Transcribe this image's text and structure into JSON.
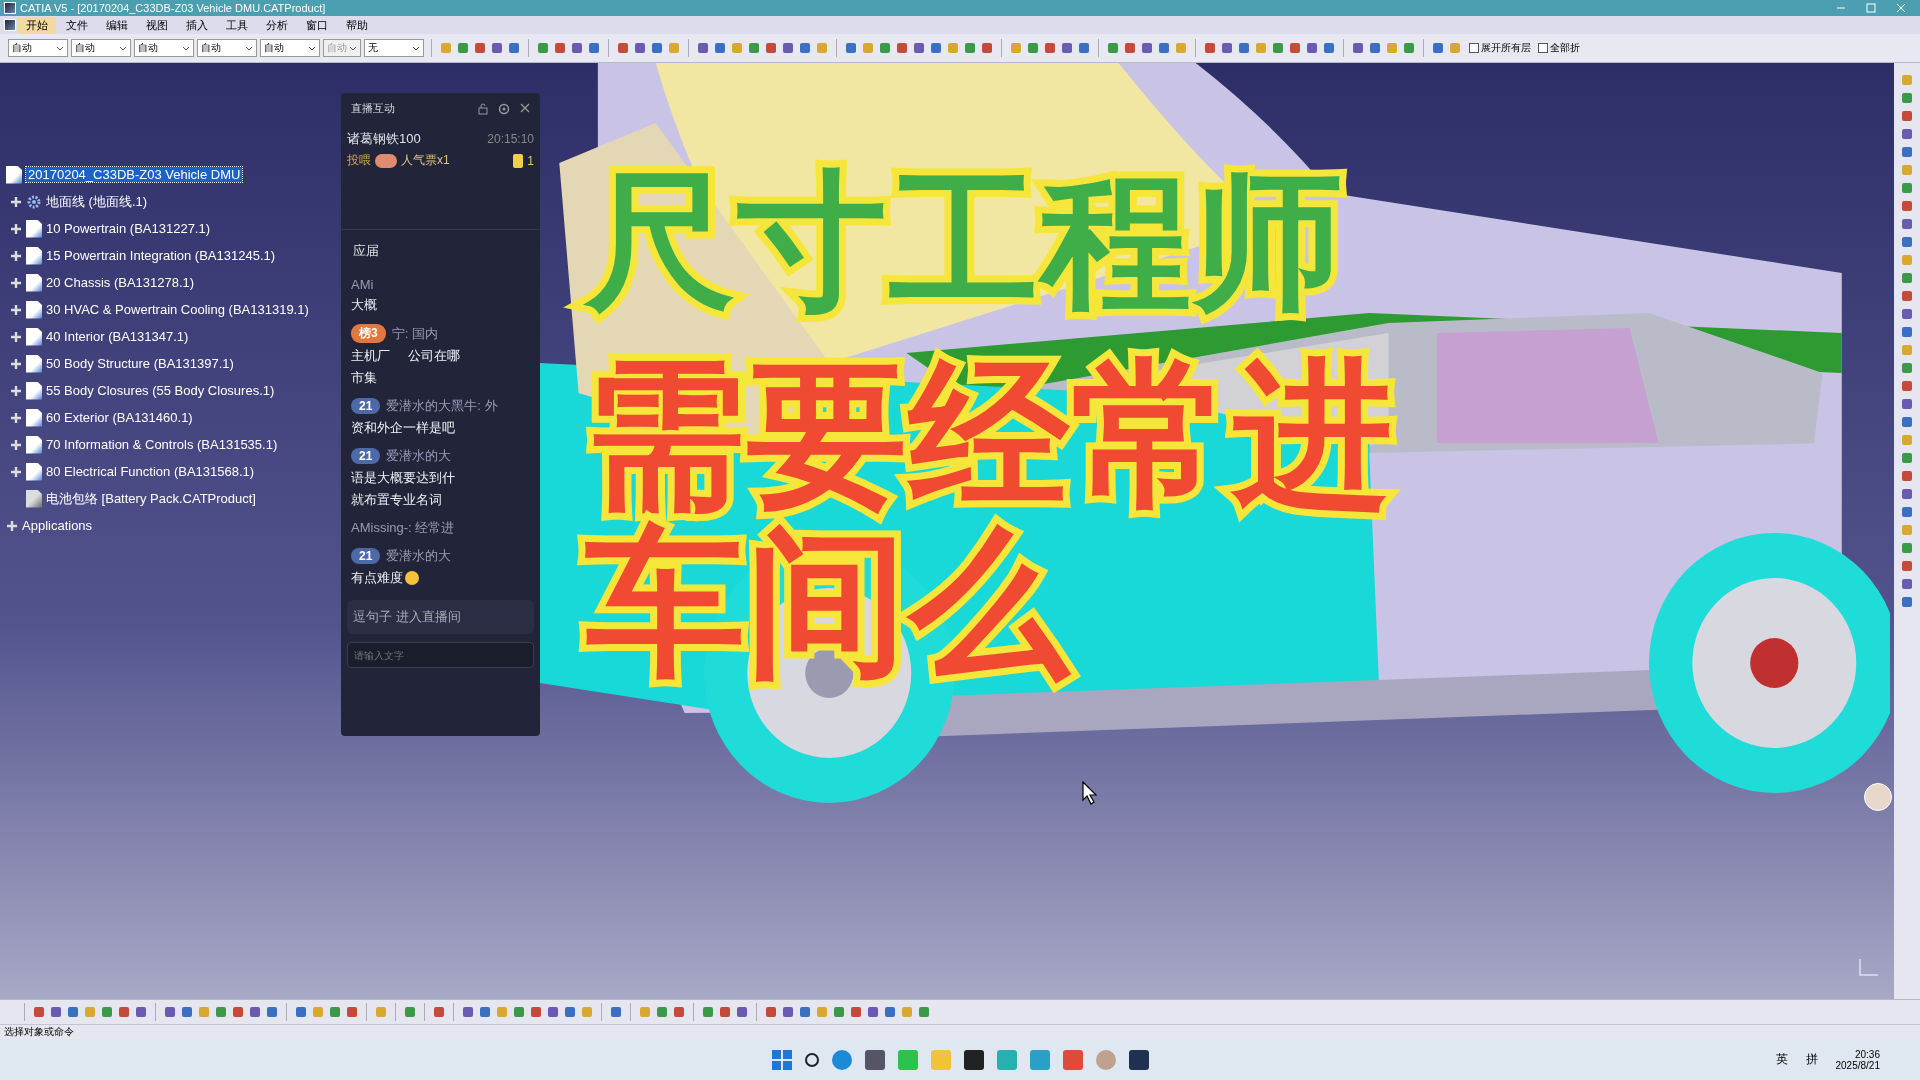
{
  "window": {
    "title": "CATIA V5 - [20170204_C33DB-Z03 Vehicle DMU.CATProduct]"
  },
  "menu": [
    {
      "label": "开始",
      "selected": true
    },
    {
      "label": "文件",
      "selected": false
    },
    {
      "label": "编辑",
      "selected": false
    },
    {
      "label": "视图",
      "selected": false
    },
    {
      "label": "插入",
      "selected": false
    },
    {
      "label": "工具",
      "selected": false
    },
    {
      "label": "分析",
      "selected": false
    },
    {
      "label": "窗口",
      "selected": false
    },
    {
      "label": "帮助",
      "selected": false
    }
  ],
  "toolbar": {
    "dropdowns": [
      {
        "value": "自动",
        "disabled": false
      },
      {
        "value": "自动",
        "disabled": false
      },
      {
        "value": "自动",
        "disabled": false
      },
      {
        "value": "自动",
        "disabled": false
      },
      {
        "value": "自动",
        "disabled": false
      },
      {
        "value": "自动",
        "disabled": true
      },
      {
        "value": "无",
        "disabled": false
      }
    ],
    "checkboxes": [
      {
        "label": "展开所有层",
        "checked": false
      },
      {
        "label": "全部折",
        "checked": false
      }
    ]
  },
  "tree": {
    "root": {
      "label": "20170204_C33DB-Z03 Vehicle DMU",
      "selected": true
    },
    "items": [
      {
        "label": "地面线 (地面线.1)",
        "kind": "geometry",
        "selected": false
      },
      {
        "label": "10 Powertrain (BA131227.1)",
        "kind": "product",
        "selected": false
      },
      {
        "label": "15 Powertrain Integration (BA131245.1)",
        "kind": "product",
        "selected": false
      },
      {
        "label": "20 Chassis (BA131278.1)",
        "kind": "product",
        "selected": false
      },
      {
        "label": "30 HVAC & Powertrain Cooling (BA131319.1)",
        "kind": "product",
        "selected": false
      },
      {
        "label": "40 Interior (BA131347.1)",
        "kind": "product",
        "selected": false
      },
      {
        "label": "50 Body Structure (BA131397.1)",
        "kind": "product",
        "selected": false
      },
      {
        "label": "55 Body Closures (55 Body Closures.1)",
        "kind": "product",
        "selected": false
      },
      {
        "label": "60 Exterior (BA131460.1)",
        "kind": "product",
        "selected": false
      },
      {
        "label": "70 Information & Controls (BA131535.1)",
        "kind": "product",
        "selected": false
      },
      {
        "label": "80 Electrical Function (BA131568.1)",
        "kind": "product",
        "selected": false
      },
      {
        "label": "电池包络 [Battery Pack.CATProduct]",
        "kind": "leaf",
        "selected": false
      }
    ],
    "applications": {
      "label": "Applications",
      "selected": false
    }
  },
  "chat": {
    "title": "直播互动",
    "gift": {
      "user": "诸葛钢铁100",
      "time": "20:15:10",
      "action": "投喂",
      "item": "人气票x1",
      "count": "1"
    },
    "section": "应届",
    "messages": [
      {
        "head": "AMi",
        "body": [
          [
            "大概"
          ]
        ]
      },
      {
        "badge": {
          "text": "榜3",
          "kind": "rank"
        },
        "head": "宁: 国内",
        "body": [
          [
            "主机厂",
            "公司在哪"
          ],
          [
            "市集"
          ]
        ]
      },
      {
        "badge": {
          "text": "21",
          "kind": "fan"
        },
        "head": "爱潜水的大黑牛: 外",
        "body": [
          [
            "资和外企一样是吧"
          ]
        ]
      },
      {
        "badge": {
          "text": "21",
          "kind": "fan"
        },
        "head": "爱潜水的大",
        "body": [
          [
            "语是大概要达到什"
          ],
          [
            "就布置专业名词"
          ]
        ]
      },
      {
        "head": "AMissing-: 经常进"
      },
      {
        "badge": {
          "text": "21",
          "kind": "fan"
        },
        "head": "爱潜水的大",
        "body": [
          [
            "有点难度"
          ]
        ],
        "emoji": true
      }
    ],
    "notice": "逗句子 进入直播间",
    "input": {
      "placeholder": "请输入文字"
    }
  },
  "overlay_caption": [
    {
      "text": "尺寸工程师",
      "color": "#3fae49"
    },
    {
      "text": "需要经常进",
      "color": "#f04a33"
    },
    {
      "text": "车间么",
      "color": "#f04a33"
    }
  ],
  "status_bar": {
    "text": "选择对象或命令"
  },
  "taskbar": {
    "ime_lang": "英",
    "ime_mode": "拼",
    "time": "20:36",
    "date": "2025/8/21"
  }
}
